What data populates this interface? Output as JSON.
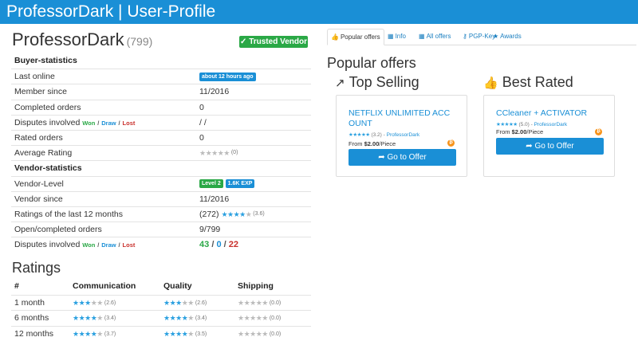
{
  "topbar": {
    "title": "ProfessorDark | User-Profile"
  },
  "profile": {
    "name": "ProfessorDark",
    "count": "(799)",
    "trusted_badge": "Trusted Vendor"
  },
  "buyer_stats": {
    "header": "Buyer-statistics",
    "last_online_label": "Last online",
    "last_online_value": "about 12 hours ago",
    "member_since_label": "Member since",
    "member_since_value": "11/2016",
    "completed_orders_label": "Completed orders",
    "completed_orders_value": "0",
    "disputes_label": "Disputes involved",
    "won": "Won",
    "draw": "Draw",
    "lost": "Lost",
    "slash": "/",
    "disputes_value": "/ /",
    "rated_orders_label": "Rated orders",
    "rated_orders_value": "0",
    "avg_rating_label": "Average Rating",
    "avg_rating_note": "(0)"
  },
  "vendor_stats": {
    "header": "Vendor-statistics",
    "vendor_level_label": "Vendor-Level",
    "vendor_level_badge": "Level 2",
    "exp_badge": "1.6K EXP",
    "vendor_since_label": "Vendor since",
    "vendor_since_value": "11/2016",
    "ratings12_label": "Ratings of the last 12 months",
    "ratings12_count": "(272)",
    "ratings12_note": "(3.6)",
    "open_completed_label": "Open/completed orders",
    "open_completed_value": "9/799",
    "disputes_label": "Disputes involved",
    "won": "Won",
    "draw": "Draw",
    "lost": "Lost",
    "slash": "/",
    "disputes_won": "43",
    "disputes_draw": "0",
    "disputes_lost": "22"
  },
  "ratings": {
    "title": "Ratings",
    "headers": [
      "#",
      "Communication",
      "Quality",
      "Shipping"
    ],
    "rows": [
      {
        "period": "1 month",
        "communication": "(2.6)",
        "quality": "(2.6)",
        "shipping": "(0.0)"
      },
      {
        "period": "6 months",
        "communication": "(3.4)",
        "quality": "(3.4)",
        "shipping": "(0.0)"
      },
      {
        "period": "12 months",
        "communication": "(3.7)",
        "quality": "(3.5)",
        "shipping": "(0.0)"
      }
    ]
  },
  "tabs": [
    {
      "label": "Popular offers",
      "icon": "thumbs-up-icon"
    },
    {
      "label": "Info",
      "icon": "calendar-icon"
    },
    {
      "label": "All offers",
      "icon": "grid-icon"
    },
    {
      "label": "PGP-Key",
      "icon": "key-icon"
    },
    {
      "label": "Awards",
      "icon": "star-icon"
    }
  ],
  "offers": {
    "title": "Popular offers",
    "top_selling_label": "Top Selling",
    "best_rated_label": "Best Rated",
    "cards": [
      {
        "title": "NETFLIX UNLIMITED ACC OUNT",
        "rating_note": "(3.2)",
        "sep": "-",
        "vendor": "ProfessorDark",
        "price_prefix": "From",
        "price": "$2.00",
        "unit": "/Piece",
        "button": "Go to Offer"
      },
      {
        "title": "CCleaner + ACTIVATOR",
        "rating_note": "(5.0)",
        "sep": "-",
        "vendor": "ProfessorDark",
        "price_prefix": "From",
        "price": "$2.00",
        "unit": "/Piece",
        "button": "Go to Offer"
      }
    ]
  },
  "colors": {
    "topbar": "#1a8fd6",
    "trusted": "#2aa846",
    "won": "#2aa846",
    "draw": "#1a8fd6",
    "lost": "#c9302c",
    "bitcoin": "#f7931a"
  }
}
